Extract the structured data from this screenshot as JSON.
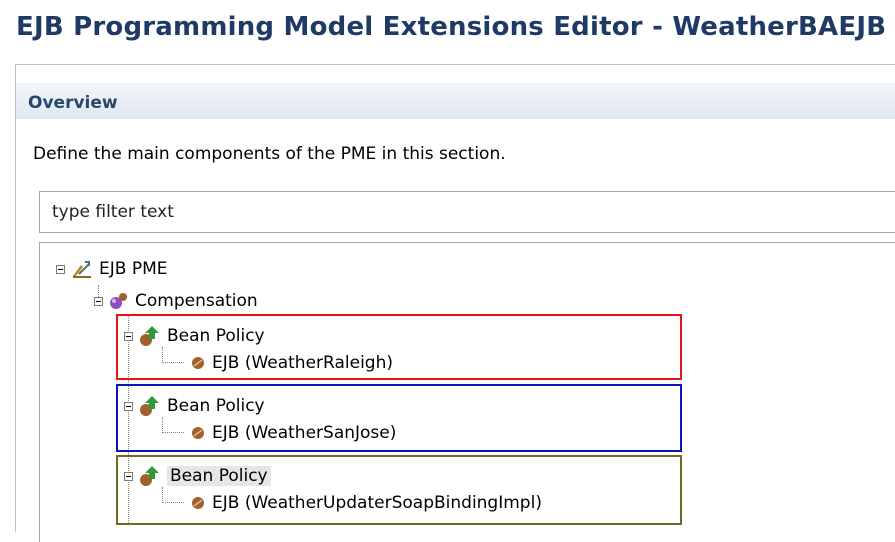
{
  "window": {
    "title": "EJB Programming Model Extensions Editor - WeatherBAEJB"
  },
  "section": {
    "title": "Overview",
    "description": "Define the main components of the PME in this section."
  },
  "filter": {
    "placeholder": "type filter text"
  },
  "tree": {
    "root": {
      "label": "EJB PME",
      "icon": "pme-icon"
    },
    "compensation": {
      "label": "Compensation",
      "icon": "compensation-icon"
    },
    "policies": [
      {
        "label": "Bean Policy",
        "child": "EJB (WeatherRaleigh)",
        "highlight_color": "#e3141c"
      },
      {
        "label": "Bean Policy",
        "child": "EJB (WeatherSanJose)",
        "highlight_color": "#0a17b5"
      },
      {
        "label": "Bean Policy",
        "child": "EJB (WeatherUpdaterSoapBindingImpl)",
        "highlight_color": "#6d6a22"
      }
    ]
  },
  "colors": {
    "title": "#1f3a64",
    "section_header": "#27466c"
  }
}
